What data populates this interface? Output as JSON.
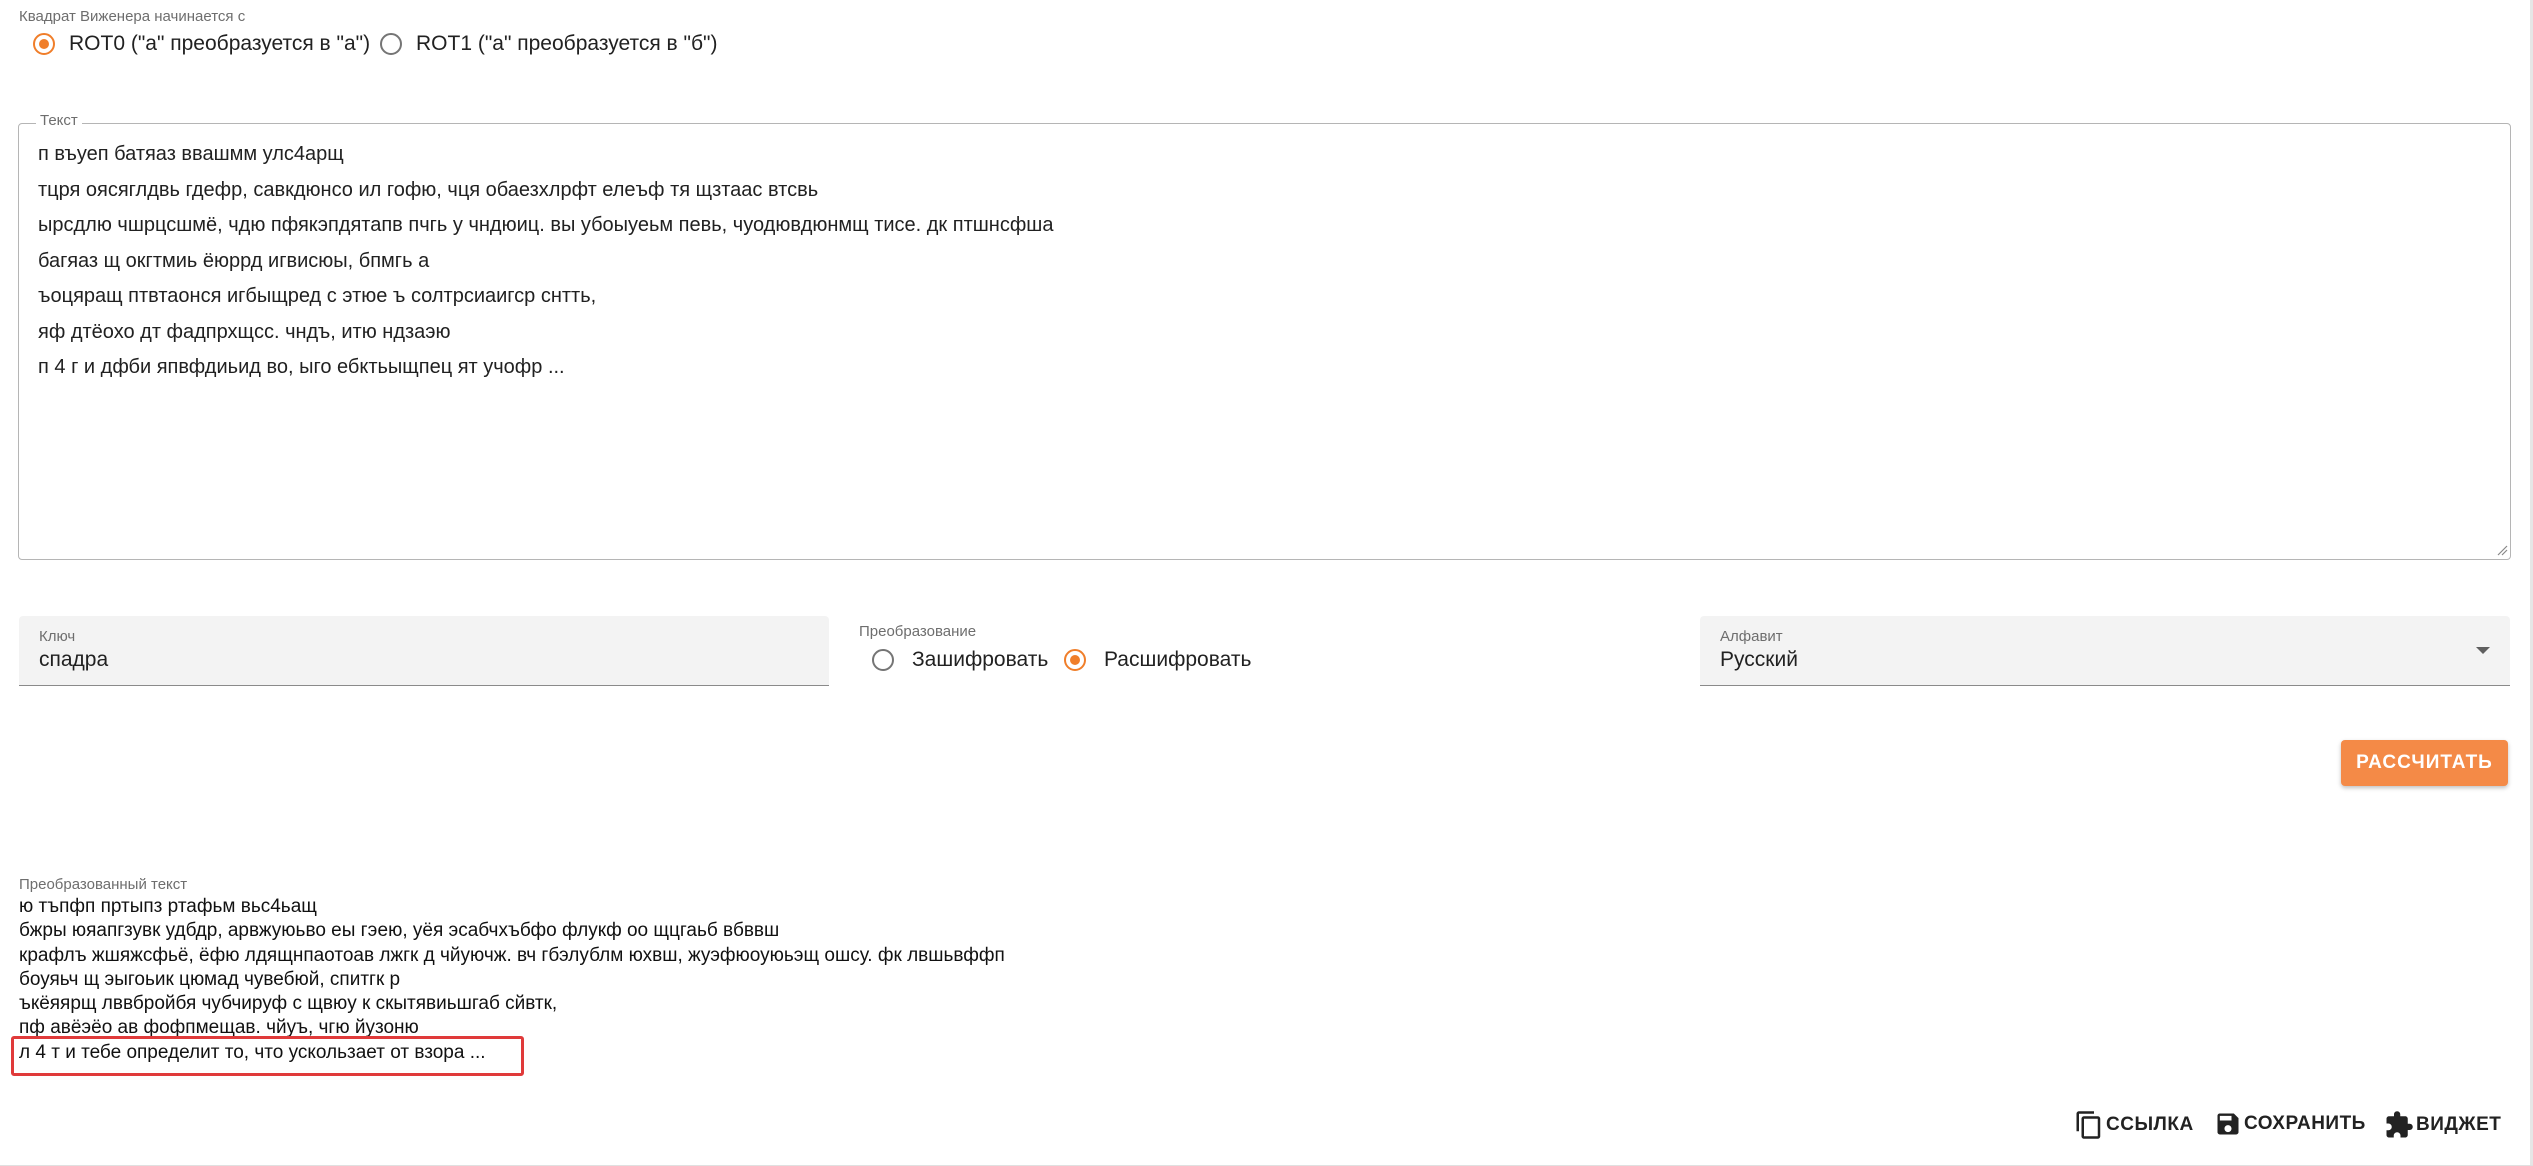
{
  "rot_setting": {
    "label": "Квадрат Виженера начинается с",
    "options": [
      {
        "label": "ROT0 (\"а\" преобразуется в \"а\")",
        "checked": true
      },
      {
        "label": "ROT1 (\"а\" преобразуется в \"б\")",
        "checked": false
      }
    ]
  },
  "text_input": {
    "label": "Текст",
    "lines": [
      "п въуеп батяаз ввашмм улс4арщ",
      "тцря оясяглдвь гдефр, савкдюнсо ил гофю, чця обаезхлрфт елеъф тя щзтаас втсвь",
      "ырсдлю чшрцсшмё, чдю пфякэпдятапв пчгь у чндюиц. вы убоыуеьм певь, чуодювдюнмщ тисе. дк птшнсфша",
      "багяаз щ окгтмиь ёюррд игвисюы, бпмгь а",
      "ъоцяращ птвтаонся игбыщред с этюе ъ солтрсиаигср снтть,",
      "яф дтёохо дт фадпрхщсс. чндъ, итю ндзаэю",
      "п 4 г и дфби япвфдиьид во, ыго ебктьыщпец ят учофр ..."
    ]
  },
  "key_field": {
    "label": "Ключ",
    "value": "спадра"
  },
  "transform": {
    "label": "Преобразование",
    "options": [
      {
        "label": "Зашифровать",
        "checked": false
      },
      {
        "label": "Расшифровать",
        "checked": true
      }
    ]
  },
  "alphabet": {
    "label": "Алфавит",
    "value": "Русский"
  },
  "calculate_button": "РАССЧИТАТЬ",
  "output": {
    "label": "Преобразованный текст",
    "lines": [
      "ю тъпфп пртыпз ртафьм вьс4ьащ",
      "бжры юяапгзувк удбдр, арвжуюьво еы гэею, уёя эсабчхъбфо флукф оо щцгаьб вбввш",
      "крафлъ жшяжсфьё, ёфю лдящнпаотоав лжгк д чйуючж. вч гбэлублм юхвш, жуэфюоуюьэщ ошсу. фк лвшьвффп",
      "боуяьч щ эыгоьик цюмад чувебюй, спитгк р",
      "ъкёяярщ лввбройбя чубчируф с щвюу к скытявиьшгаб сйвтк,",
      "пф авёэёо ав фофпмещав. чйуъ, чгю йузоню",
      "л 4 т и тебе определит то, что ускользает от взора ..."
    ]
  },
  "actions": {
    "link": "ССЫЛКА",
    "save": "СОХРАНИТЬ",
    "widget": "ВИДЖЕТ"
  },
  "colors": {
    "accent": "#f07e2a",
    "highlight": "#e03a3a"
  }
}
